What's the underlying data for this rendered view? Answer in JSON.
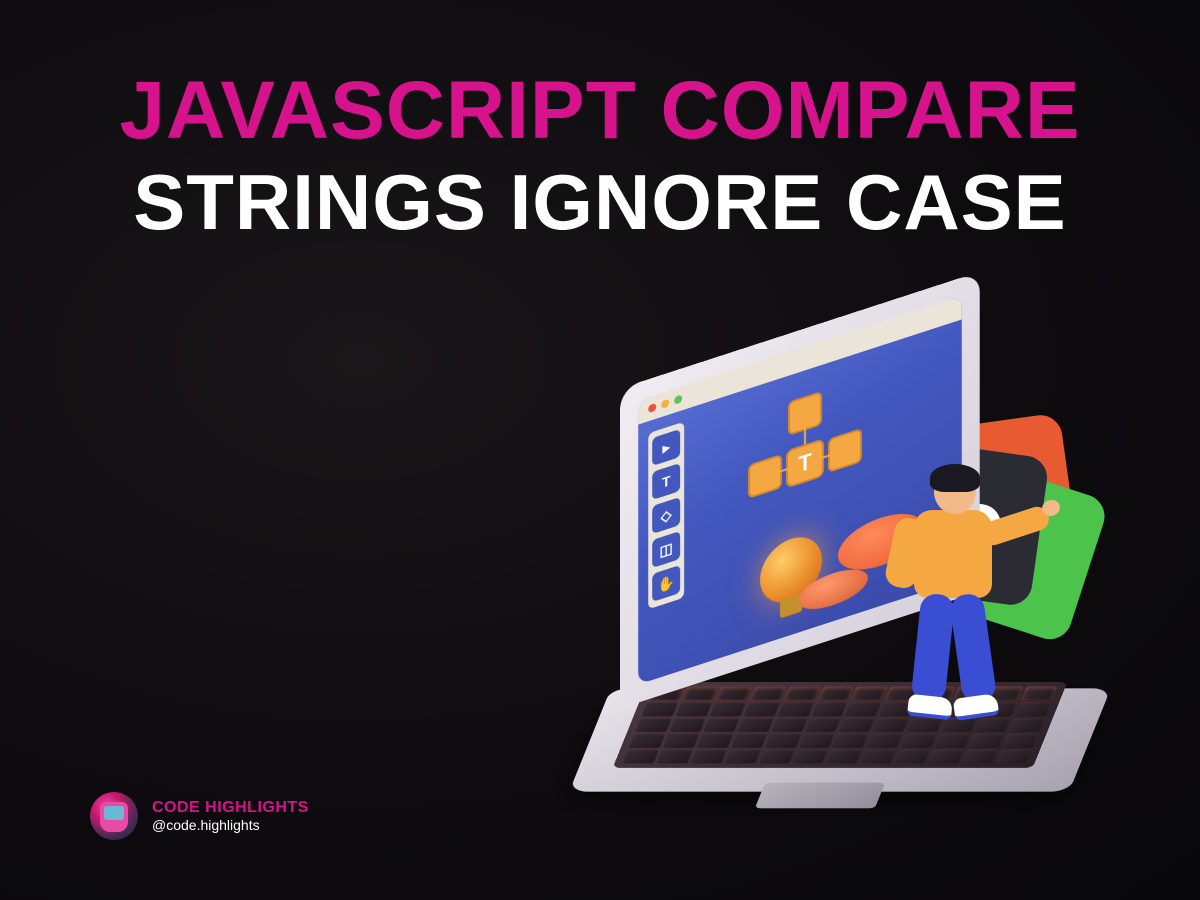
{
  "title": {
    "line1": "JAVASCRIPT COMPARE",
    "line2": "STRINGS IGNORE CASE"
  },
  "attribution": {
    "brand": "CODE HIGHLIGHTS",
    "handle": "@code.highlights"
  },
  "colors": {
    "accent": "#d6138d",
    "background": "#0d0b0e"
  },
  "screen": {
    "node_label": "T"
  }
}
